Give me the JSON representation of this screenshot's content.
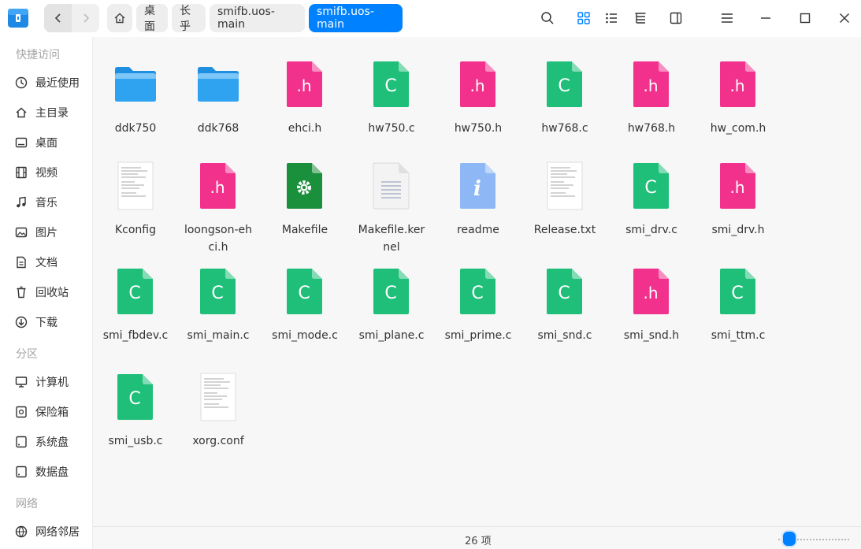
{
  "titlebar": {
    "breadcrumbs": [
      "桌面",
      "长乎",
      "smifb.uos-main",
      "smifb.uos-main"
    ]
  },
  "sidebar": {
    "quick_access_title": "快捷访问",
    "quick_items": [
      {
        "label": "最近使用",
        "icon": "clock-icon"
      },
      {
        "label": "主目录",
        "icon": "home-icon"
      },
      {
        "label": "桌面",
        "icon": "desktop-icon"
      },
      {
        "label": "视频",
        "icon": "film-icon"
      },
      {
        "label": "音乐",
        "icon": "music-icon"
      },
      {
        "label": "图片",
        "icon": "image-icon"
      },
      {
        "label": "文档",
        "icon": "document-icon"
      },
      {
        "label": "回收站",
        "icon": "trash-icon"
      },
      {
        "label": "下载",
        "icon": "download-icon"
      }
    ],
    "partitions_title": "分区",
    "partition_items": [
      {
        "label": "计算机",
        "icon": "computer-icon"
      },
      {
        "label": "保险箱",
        "icon": "safe-icon"
      },
      {
        "label": "系统盘",
        "icon": "disk-icon"
      },
      {
        "label": "数据盘",
        "icon": "disk-icon"
      }
    ],
    "network_title": "网络",
    "network_items": [
      {
        "label": "网络邻居",
        "icon": "network-icon"
      }
    ]
  },
  "files": [
    {
      "name": "ddk750",
      "type": "folder"
    },
    {
      "name": "ddk768",
      "type": "folder"
    },
    {
      "name": "ehci.h",
      "type": "h"
    },
    {
      "name": "hw750.c",
      "type": "c"
    },
    {
      "name": "hw750.h",
      "type": "h"
    },
    {
      "name": "hw768.c",
      "type": "c"
    },
    {
      "name": "hw768.h",
      "type": "h"
    },
    {
      "name": "hw_com.h",
      "type": "h"
    },
    {
      "name": "Kconfig",
      "type": "textpreview"
    },
    {
      "name": "loongson-ehci.h",
      "type": "h"
    },
    {
      "name": "Makefile",
      "type": "makefile"
    },
    {
      "name": "Makefile.kernel",
      "type": "plain"
    },
    {
      "name": "readme",
      "type": "info"
    },
    {
      "name": "Release.txt",
      "type": "textpreview"
    },
    {
      "name": "smi_drv.c",
      "type": "c"
    },
    {
      "name": "smi_drv.h",
      "type": "h"
    },
    {
      "name": "smi_fbdev.c",
      "type": "c"
    },
    {
      "name": "smi_main.c",
      "type": "c"
    },
    {
      "name": "smi_mode.c",
      "type": "c"
    },
    {
      "name": "smi_plane.c",
      "type": "c"
    },
    {
      "name": "smi_prime.c",
      "type": "c"
    },
    {
      "name": "smi_snd.c",
      "type": "c"
    },
    {
      "name": "smi_snd.h",
      "type": "h"
    },
    {
      "name": "smi_ttm.c",
      "type": "c"
    },
    {
      "name": "smi_usb.c",
      "type": "c"
    },
    {
      "name": "xorg.conf",
      "type": "textpreview"
    }
  ],
  "status": {
    "count": "26 项",
    "zoom_level": 0.05
  },
  "colors": {
    "accent": "#0081ff",
    "c_file": "#1fbf7a",
    "h_file": "#f2318c",
    "folder": "#2fa3f0"
  }
}
